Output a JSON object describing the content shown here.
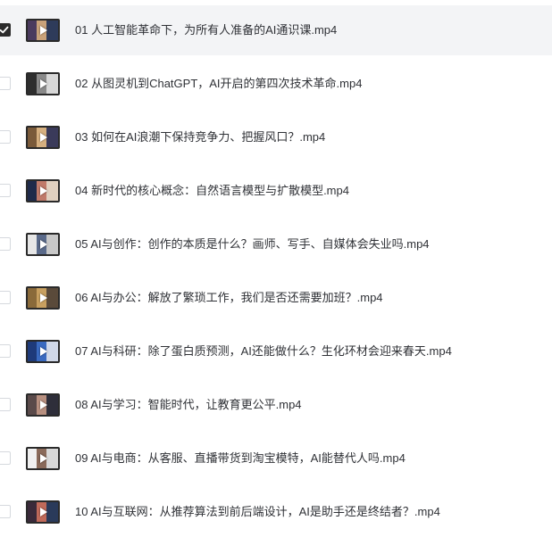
{
  "files": [
    {
      "name": "01 人工智能革命下，为所有人准备的AI通识课.mp4",
      "checked": true,
      "thumb_colors": [
        "#4a3a5e",
        "#c9a27a",
        "#2e3b5a"
      ]
    },
    {
      "name": "02 从图灵机到ChatGPT，AI开启的第四次技术革命.mp4",
      "checked": false,
      "thumb_colors": [
        "#2e2e2e",
        "#8a8a8a",
        "#d8d8d8"
      ]
    },
    {
      "name": "03 如何在AI浪潮下保持竞争力、把握风口？.mp4",
      "checked": false,
      "thumb_colors": [
        "#7a5a3a",
        "#d6b080",
        "#3a3a5a"
      ]
    },
    {
      "name": "04 新时代的核心概念：自然语言模型与扩散模型.mp4",
      "checked": false,
      "thumb_colors": [
        "#1f2a4a",
        "#c07a6a",
        "#e0d0c0"
      ]
    },
    {
      "name": "05 AI与创作：创作的本质是什么？画师、写手、自媒体会失业吗.mp4",
      "checked": false,
      "thumb_colors": [
        "#e6e6e6",
        "#5a6a8a",
        "#c8c8c8"
      ]
    },
    {
      "name": "06 AI与办公：解放了繁琐工作，我们是否还需要加班？.mp4",
      "checked": false,
      "thumb_colors": [
        "#8a6a3a",
        "#c8a060",
        "#5a4a3a"
      ]
    },
    {
      "name": "07 AI与科研：除了蛋白质预测，AI还能做什么？生化环材会迎来春天.mp4",
      "checked": false,
      "thumb_colors": [
        "#1e3a7a",
        "#3a6ac0",
        "#d0d8e8"
      ]
    },
    {
      "name": "08 AI与学习：智能时代，让教育更公平.mp4",
      "checked": false,
      "thumb_colors": [
        "#5a4a4a",
        "#b89080",
        "#2e2e3a"
      ]
    },
    {
      "name": "09 AI与电商：从客服、直播带货到淘宝模特，AI能替代人吗.mp4",
      "checked": false,
      "thumb_colors": [
        "#f0f0f0",
        "#8a6a5a",
        "#d8d8d8"
      ]
    },
    {
      "name": "10 AI与互联网：从推荐算法到前后端设计，AI是助手还是终结者？.mp4",
      "checked": false,
      "thumb_colors": [
        "#3a2a3a",
        "#c06a5a",
        "#2a3a5a"
      ]
    }
  ],
  "colors": {
    "selected_row_bg": "#f3f4f6",
    "text": "#2f3136",
    "checkbox_border": "#d6d9de",
    "checkbox_checked": "#2b2b2b"
  }
}
